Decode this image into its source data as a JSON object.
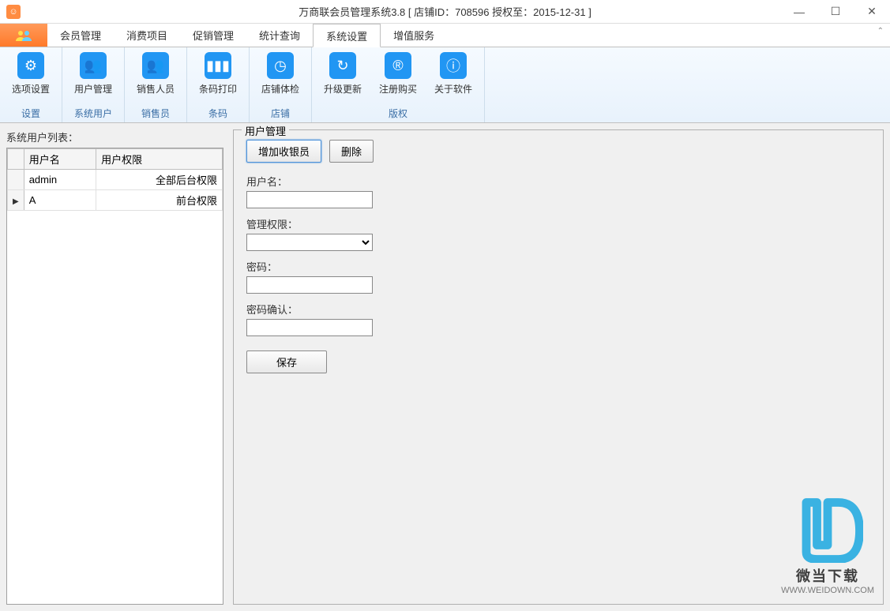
{
  "window": {
    "title": "万商联会员管理系统3.8  [ 店铺ID：708596 授权至：2015-12-31 ]"
  },
  "menu": {
    "items": [
      "会员管理",
      "消费项目",
      "促销管理",
      "统计查询",
      "系统设置",
      "增值服务"
    ],
    "active_index": 4
  },
  "ribbon": {
    "groups": [
      {
        "label": "设置",
        "items": [
          {
            "label": "选项设置",
            "icon": "gear"
          }
        ]
      },
      {
        "label": "系统用户",
        "items": [
          {
            "label": "用户管理",
            "icon": "users"
          }
        ]
      },
      {
        "label": "销售员",
        "items": [
          {
            "label": "销售人员",
            "icon": "users"
          }
        ]
      },
      {
        "label": "条码",
        "items": [
          {
            "label": "条码打印",
            "icon": "barcode"
          }
        ]
      },
      {
        "label": "店铺",
        "items": [
          {
            "label": "店铺体检",
            "icon": "clock"
          }
        ]
      },
      {
        "label": "版权",
        "items": [
          {
            "label": "升级更新",
            "icon": "refresh"
          },
          {
            "label": "注册购买",
            "icon": "registered"
          },
          {
            "label": "关于软件",
            "icon": "info"
          }
        ]
      }
    ]
  },
  "left": {
    "title": "系统用户列表：",
    "columns": [
      "用户名",
      "用户权限"
    ],
    "rows": [
      {
        "username": "admin",
        "perm": "全部后台权限",
        "selected": false
      },
      {
        "username": "A",
        "perm": "前台权限",
        "selected": true
      }
    ]
  },
  "right": {
    "legend": "用户管理",
    "add_btn": "增加收银员",
    "del_btn": "删除",
    "fields": {
      "username_label": "用户名：",
      "username_value": "",
      "perm_label": "管理权限：",
      "perm_value": "",
      "password_label": "密码：",
      "password_value": "",
      "confirm_label": "密码确认：",
      "confirm_value": ""
    },
    "save_btn": "保存"
  },
  "watermark": {
    "line1": "微当下载",
    "line2": "WWW.WEIDOWN.COM"
  }
}
